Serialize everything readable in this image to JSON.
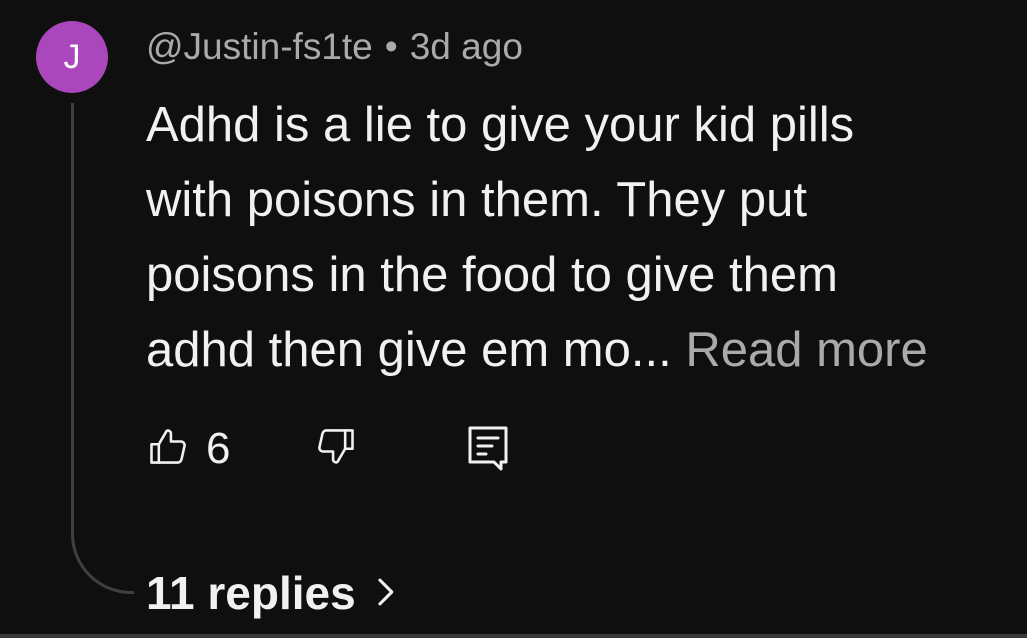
{
  "comment": {
    "avatar_initial": "J",
    "avatar_color": "#ab47bc",
    "author": "@Justin-fs1te",
    "separator": "•",
    "timestamp": "3d ago",
    "text_lines": [
      "Adhd is a lie to give your kid pills",
      "with poisons in them. They put",
      "poisons in the food to give them",
      "adhd then give em mo..."
    ],
    "read_more_label": "Read more",
    "like_count": "6",
    "icons": {
      "like": "thumbs-up-icon",
      "dislike": "thumbs-down-icon",
      "reply": "reply-comment-icon",
      "replies_chevron": "chevron-right-icon"
    },
    "replies_label": "11 replies"
  }
}
